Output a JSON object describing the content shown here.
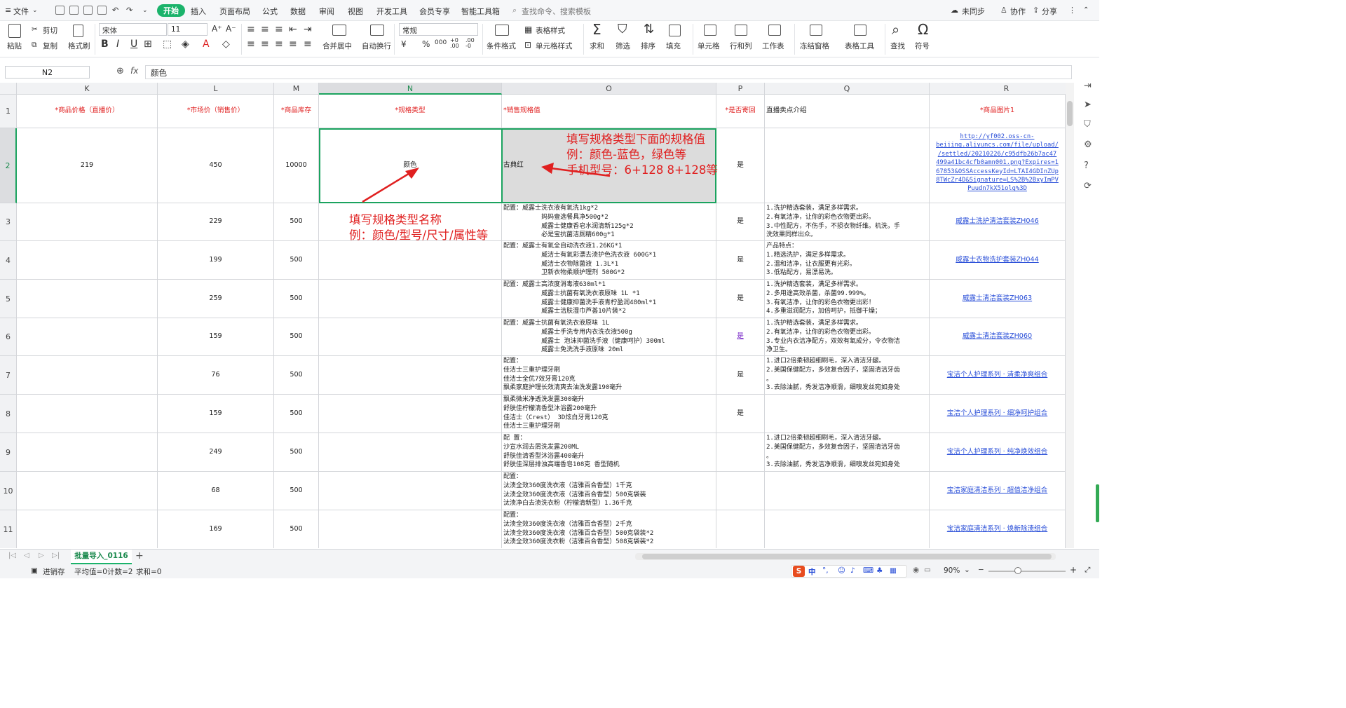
{
  "menu": {
    "file": "文件",
    "items": [
      "开始",
      "插入",
      "页面布局",
      "公式",
      "数据",
      "审阅",
      "视图",
      "开发工具",
      "会员专享",
      "智能工具箱"
    ],
    "search": "查找命令、搜索模板",
    "right": {
      "sync": "未同步",
      "collab": "协作",
      "share": "分享"
    }
  },
  "ribbon": {
    "paste": "粘贴",
    "cut": "剪切",
    "copy": "复制",
    "format_painter": "格式刷",
    "font_name": "宋体",
    "font_size": "11",
    "number_format": "常规",
    "merge": "合并居中",
    "wrap": "自动换行",
    "cond_format": "条件格式",
    "table_style": "表格样式",
    "cell_style": "单元格样式",
    "sum": "求和",
    "filter": "筛选",
    "sort": "排序",
    "fill": "填充",
    "cell": "单元格",
    "rowcol": "行和列",
    "sheet": "工作表",
    "freeze": "冻结窗格",
    "table_tools": "表格工具",
    "find": "查找",
    "symbol": "符号",
    "font_buttons": [
      "B",
      "I",
      "U"
    ],
    "num_buttons": [
      "¥",
      "%",
      "000"
    ]
  },
  "formula_bar": {
    "name_box": "N2",
    "fx": "fx",
    "value": "颜色"
  },
  "columns": [
    "K",
    "L",
    "M",
    "N",
    "O",
    "P",
    "Q",
    "R"
  ],
  "headers": {
    "K": "*商品价格（直播价）",
    "L": "*市场价（销售价）",
    "M": "*商品库存",
    "N": "*规格类型",
    "O": "*销售规格值",
    "P": "*是否寄回",
    "Q": "直播卖点介绍",
    "R": "*商品图片1"
  },
  "rows": [
    {
      "n": "2",
      "K": "219",
      "L": "450",
      "M": "10000",
      "N": "颜色",
      "O": "古典红",
      "P": "是",
      "Q": "",
      "R": "http://yf002.oss-cn-\nbeijing.aliyuncs.com/file/upload/\n/settled/20210226/c95dfb26b7ac47\n499a41bc4cfb0amn001.png?Expires=1\n67853&OSSAccessKeyId=LTAI4GDInZUp\n8TWcZr4D&Signature=LS%2B%2BxyImPV\nPuudn7kX51olg%3D"
    },
    {
      "n": "3",
      "K": "",
      "L": "229",
      "M": "500",
      "N": "",
      "O": "配置：威露士洗衣液有氧洗1kg*2\n          妈妈壹选餐具净500g*2\n          威露士健康香皂水润清新125g*2\n          必是宝抗菌洁厕精600g*1",
      "P": "是",
      "Q": "1.洗护精选套装，满足多样需求。\n2.有氧洁净，让你的彩色衣物更出彩。\n3.中性配方，不伤手，不损衣物纤维。机洗，手\n洗效果同样出众。",
      "R": "威露士洗护清洁套装ZH046"
    },
    {
      "n": "4",
      "K": "",
      "L": "199",
      "M": "500",
      "N": "",
      "O": "配置：威露士有氧全自动洗衣液1.26KG*1\n          威洁士有氧彩漂去渍护色洗衣液 600G*1\n          威洁士衣物除菌液 1.3L*1\n          卫新衣物柔顺护理剂 500G*2",
      "P": "是",
      "Q": "产品特点：\n1.精选洗护，满足多样需求。\n2.温和洁净，让衣服更有光彩。\n3.低粘配方，易漂易洗。",
      "R": "威露士衣物洗护套装ZH044"
    },
    {
      "n": "5",
      "K": "",
      "L": "259",
      "M": "500",
      "N": "",
      "O": "配置：威露士高浓度消毒液630ml*1\n          威露士抗菌有氧洗衣液原味 1L *1\n          威露士健康抑菌洗手液青柠盈润480ml*1\n          威露士洁肤湿巾芦荟10片装*2",
      "P": "是",
      "Q": "1.洗护精选套装，满足多样需求。\n2.多用途高效杀菌，杀菌99.999%。\n3.有氧洁净，让你的彩色衣物更出彩！\n4.多重滋润配方，加倍呵护，抵御干燥；",
      "R": "威露士清洁套装ZH063"
    },
    {
      "n": "6",
      "K": "",
      "L": "159",
      "M": "500",
      "N": "",
      "O": "配置：威露士抗菌有氧洗衣液原味 1L\n          威露士手洗专用内衣洗衣液500g\n          威露士 泡沫抑菌洗手液（健康呵护）300ml\n          威露士免洗洗手液原味 20ml",
      "P": "是",
      "Q": "1.洗护精选套装，满足多样需求。\n2.有氧洁净，让你的彩色衣物更出彩。\n3.专业内衣洁净配方，双效有氧成分，令衣物洁\n净卫生。",
      "R": "威露士清洁套装ZH060"
    },
    {
      "n": "7",
      "K": "",
      "L": "76",
      "M": "500",
      "N": "",
      "O": "配置：\n佳洁士三重护理牙刷\n佳洁士全优7效牙膏120克\n飘柔家庭护理长效清爽去油洗发露190毫升",
      "P": "是",
      "Q": "1.进口2倍柔韧超细刷毛，深入清洁牙龈。\n2.美国保健配方，多效复合因子，坚固清洁牙齿\n。\n3.去除油腻，秀发洁净顺滑，细嗅发丝宛如身处",
      "R": "宝洁个人护理系列 · 清柔净爽组合"
    },
    {
      "n": "8",
      "K": "",
      "L": "159",
      "M": "500",
      "N": "",
      "O": "飘柔微米净透洗发露300毫升\n舒肤佳柠檬清香型沐浴露200毫升\n佳洁士（Crest） 3D炫白牙膏120克\n佳洁士三重护理牙刷",
      "P": "是",
      "Q": "",
      "R": "宝洁个人护理系列 · 细净呵护组合"
    },
    {
      "n": "9",
      "K": "",
      "L": "249",
      "M": "500",
      "N": "",
      "O": "配 置：\n沙宣水润去屑洗发露200ML\n舒肤佳清香型沐浴露400毫升\n舒肤佳深层排浊高端香皂108克 香型随机",
      "P": "",
      "Q": "1.进口2倍柔韧超细刷毛，深入清洁牙龈。\n2.美国保健配方，多效复合因子，坚固清洁牙齿\n。\n3.去除油腻，秀发洁净顺滑，细嗅发丝宛如身处",
      "R": "宝洁个人护理系列 · 纯净焕效组合"
    },
    {
      "n": "10",
      "K": "",
      "L": "68",
      "M": "500",
      "N": "",
      "O": "配置：\n汰渍全效360度洗衣液（洁雅百合香型）1千克\n汰渍全效360度洗衣液（洁雅百合香型）500克袋装\n汰渍净白去渍洗衣粉（柠檬清新型）1.36千克",
      "P": "",
      "Q": "",
      "R": "宝洁家庭清洁系列 · 超值洁净组合"
    },
    {
      "n": "11",
      "K": "",
      "L": "169",
      "M": "500",
      "N": "",
      "O": "配置：\n汰渍全效360度洗衣液（洁雅百合香型）2千克\n汰渍全效360度洗衣液（洁雅百合香型）500克袋装*2\n汰渍全效360度洗衣粉（洁雅百合香型）508克袋装*2",
      "P": "",
      "Q": "",
      "R": "宝洁家庭清洁系列 · 焕新除渍组合"
    }
  ],
  "annotations": {
    "spec_value": "填写规格类型下面的规格值\n例：颜色-蓝色，绿色等\n手机型号：6+128 8+128等",
    "spec_type": "填写规格类型名称\n例：颜色/型号/尺寸/属性等"
  },
  "sheet_tab": "批量导入_0116",
  "status": {
    "macro": "进销存",
    "avg": "平均值=0",
    "count": "计数=2",
    "sum": "求和=0",
    "zoom": "90%",
    "ime": "中"
  },
  "colors": {
    "accent": "#1bb36b",
    "required": "#e02020",
    "link": "#2a4fd8"
  }
}
